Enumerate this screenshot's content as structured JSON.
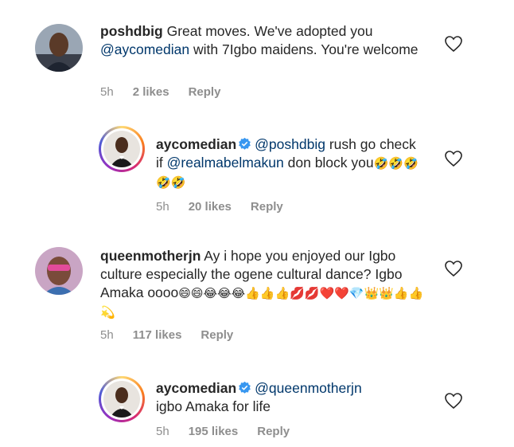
{
  "comments": [
    {
      "username": "poshdbig",
      "text_before": " Great moves. We've adopted you ",
      "mention": "@aycomedian",
      "text_after": " with 7Igbo maidens. You're welcome",
      "time": "5h",
      "likes": "2 likes",
      "reply": "Reply"
    },
    {
      "username": "aycomedian",
      "mention1": "@poshdbig",
      "text_mid": " rush go check if ",
      "mention2": "@realmabelmakun",
      "text_after": " don block you",
      "emojis": "🤣🤣🤣🤣🤣",
      "time": "5h",
      "likes": "20 likes",
      "reply": "Reply"
    },
    {
      "username": "queenmotherjn",
      "text": " Ay i hope you enjoyed our Igbo culture especially the ogene cultural dance? Igbo Amaka oooo",
      "emojis": "😄😄😂😂😂👍👍👍💋💋❤️❤️💎👑👑👍👍💫",
      "time": "5h",
      "likes": "117 likes",
      "reply": "Reply"
    },
    {
      "username": "aycomedian",
      "mention": "@queenmotherjn",
      "text_after": "igbo Amaka for life",
      "time": "5h",
      "likes": "195 likes",
      "reply": "Reply"
    }
  ],
  "icons": {
    "heart": "heart-outline-icon",
    "verified": "verified-badge-icon"
  },
  "colors": {
    "mention": "#00376b",
    "meta": "#8e8e8e",
    "verified": "#3897f0"
  }
}
